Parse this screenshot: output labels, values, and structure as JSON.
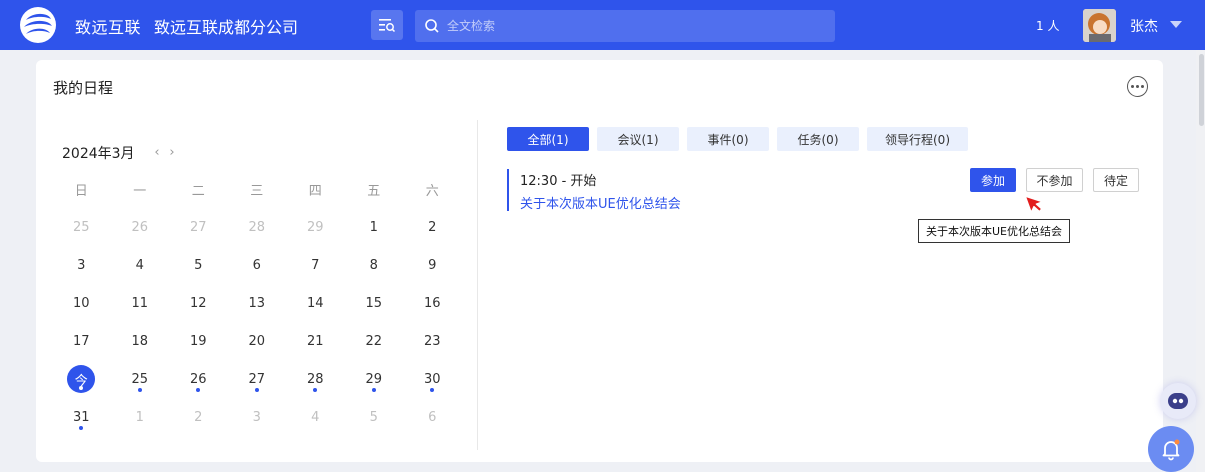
{
  "header": {
    "brand": "致远互联",
    "unit": "致远互联成都分公司",
    "search_placeholder": "全文检索",
    "online_count": "1 人",
    "user_name": "张杰"
  },
  "card": {
    "title": "我的日程",
    "calendar": {
      "month_label": "2024年3月",
      "prev": "‹",
      "next": "›",
      "weekdays": [
        "日",
        "一",
        "二",
        "三",
        "四",
        "五",
        "六"
      ],
      "days": [
        {
          "n": "25",
          "muted": true
        },
        {
          "n": "26",
          "muted": true
        },
        {
          "n": "27",
          "muted": true
        },
        {
          "n": "28",
          "muted": true
        },
        {
          "n": "29",
          "muted": true
        },
        {
          "n": "1"
        },
        {
          "n": "2"
        },
        {
          "n": "3"
        },
        {
          "n": "4"
        },
        {
          "n": "5"
        },
        {
          "n": "6"
        },
        {
          "n": "7"
        },
        {
          "n": "8"
        },
        {
          "n": "9"
        },
        {
          "n": "10"
        },
        {
          "n": "11"
        },
        {
          "n": "12"
        },
        {
          "n": "13"
        },
        {
          "n": "14"
        },
        {
          "n": "15"
        },
        {
          "n": "16"
        },
        {
          "n": "17"
        },
        {
          "n": "18"
        },
        {
          "n": "19"
        },
        {
          "n": "20"
        },
        {
          "n": "21"
        },
        {
          "n": "22"
        },
        {
          "n": "23"
        },
        {
          "n": "今",
          "today": true,
          "dot": true
        },
        {
          "n": "25",
          "dot": true
        },
        {
          "n": "26",
          "dot": true
        },
        {
          "n": "27",
          "dot": true
        },
        {
          "n": "28",
          "dot": true
        },
        {
          "n": "29",
          "dot": true
        },
        {
          "n": "30",
          "dot": true
        },
        {
          "n": "31",
          "dot": true
        },
        {
          "n": "1",
          "muted": true
        },
        {
          "n": "2",
          "muted": true
        },
        {
          "n": "3",
          "muted": true
        },
        {
          "n": "4",
          "muted": true
        },
        {
          "n": "5",
          "muted": true
        },
        {
          "n": "6",
          "muted": true
        }
      ]
    },
    "tabs": [
      {
        "label": "全部(1)",
        "active": true
      },
      {
        "label": "会议(1)"
      },
      {
        "label": "事件(0)"
      },
      {
        "label": "任务(0)"
      },
      {
        "label": "领导行程(0)"
      }
    ],
    "event": {
      "time": "12:30 - 开始",
      "title": "关于本次版本UE优化总结会"
    },
    "actions": {
      "join": "参加",
      "decline": "不参加",
      "pending": "待定"
    },
    "tooltip": "关于本次版本UE优化总结会"
  },
  "colors": {
    "accent": "#2f54eb",
    "tab_bg": "#eaf0fd"
  }
}
